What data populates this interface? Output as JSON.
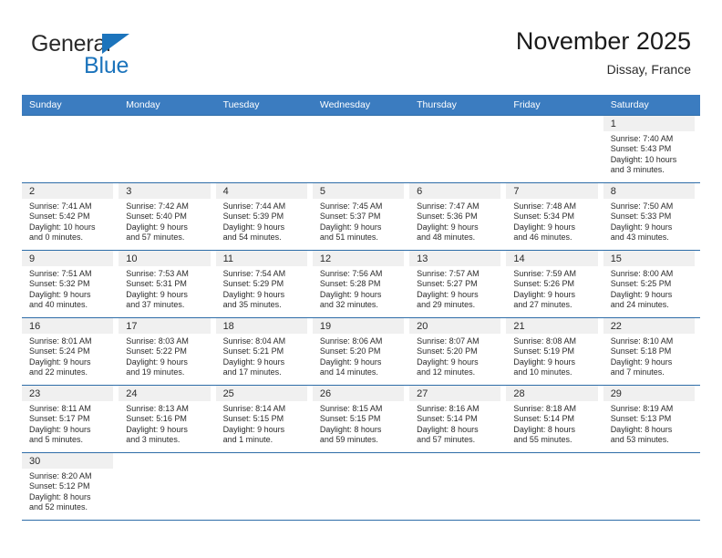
{
  "brand": {
    "name_part1": "General",
    "name_part2": "Blue",
    "triangle_color": "#1c74bc"
  },
  "header": {
    "title": "November 2025",
    "subtitle": "Dissay, France"
  },
  "colors": {
    "header_blue": "#3b7cc0",
    "row_rule_blue": "#2e6da8",
    "daynum_band": "#f0f0f0"
  },
  "weekdays": [
    "Sunday",
    "Monday",
    "Tuesday",
    "Wednesday",
    "Thursday",
    "Friday",
    "Saturday"
  ],
  "weeks": [
    [
      {
        "day": "",
        "blank": true,
        "sunrise": "",
        "sunset": "",
        "daylight1": "",
        "daylight2": ""
      },
      {
        "day": "",
        "blank": true,
        "sunrise": "",
        "sunset": "",
        "daylight1": "",
        "daylight2": ""
      },
      {
        "day": "",
        "blank": true,
        "sunrise": "",
        "sunset": "",
        "daylight1": "",
        "daylight2": ""
      },
      {
        "day": "",
        "blank": true,
        "sunrise": "",
        "sunset": "",
        "daylight1": "",
        "daylight2": ""
      },
      {
        "day": "",
        "blank": true,
        "sunrise": "",
        "sunset": "",
        "daylight1": "",
        "daylight2": ""
      },
      {
        "day": "",
        "blank": true,
        "sunrise": "",
        "sunset": "",
        "daylight1": "",
        "daylight2": ""
      },
      {
        "day": "1",
        "sunrise": "Sunrise: 7:40 AM",
        "sunset": "Sunset: 5:43 PM",
        "daylight1": "Daylight: 10 hours",
        "daylight2": "and 3 minutes."
      }
    ],
    [
      {
        "day": "2",
        "sunrise": "Sunrise: 7:41 AM",
        "sunset": "Sunset: 5:42 PM",
        "daylight1": "Daylight: 10 hours",
        "daylight2": "and 0 minutes."
      },
      {
        "day": "3",
        "sunrise": "Sunrise: 7:42 AM",
        "sunset": "Sunset: 5:40 PM",
        "daylight1": "Daylight: 9 hours",
        "daylight2": "and 57 minutes."
      },
      {
        "day": "4",
        "sunrise": "Sunrise: 7:44 AM",
        "sunset": "Sunset: 5:39 PM",
        "daylight1": "Daylight: 9 hours",
        "daylight2": "and 54 minutes."
      },
      {
        "day": "5",
        "sunrise": "Sunrise: 7:45 AM",
        "sunset": "Sunset: 5:37 PM",
        "daylight1": "Daylight: 9 hours",
        "daylight2": "and 51 minutes."
      },
      {
        "day": "6",
        "sunrise": "Sunrise: 7:47 AM",
        "sunset": "Sunset: 5:36 PM",
        "daylight1": "Daylight: 9 hours",
        "daylight2": "and 48 minutes."
      },
      {
        "day": "7",
        "sunrise": "Sunrise: 7:48 AM",
        "sunset": "Sunset: 5:34 PM",
        "daylight1": "Daylight: 9 hours",
        "daylight2": "and 46 minutes."
      },
      {
        "day": "8",
        "sunrise": "Sunrise: 7:50 AM",
        "sunset": "Sunset: 5:33 PM",
        "daylight1": "Daylight: 9 hours",
        "daylight2": "and 43 minutes."
      }
    ],
    [
      {
        "day": "9",
        "sunrise": "Sunrise: 7:51 AM",
        "sunset": "Sunset: 5:32 PM",
        "daylight1": "Daylight: 9 hours",
        "daylight2": "and 40 minutes."
      },
      {
        "day": "10",
        "sunrise": "Sunrise: 7:53 AM",
        "sunset": "Sunset: 5:31 PM",
        "daylight1": "Daylight: 9 hours",
        "daylight2": "and 37 minutes."
      },
      {
        "day": "11",
        "sunrise": "Sunrise: 7:54 AM",
        "sunset": "Sunset: 5:29 PM",
        "daylight1": "Daylight: 9 hours",
        "daylight2": "and 35 minutes."
      },
      {
        "day": "12",
        "sunrise": "Sunrise: 7:56 AM",
        "sunset": "Sunset: 5:28 PM",
        "daylight1": "Daylight: 9 hours",
        "daylight2": "and 32 minutes."
      },
      {
        "day": "13",
        "sunrise": "Sunrise: 7:57 AM",
        "sunset": "Sunset: 5:27 PM",
        "daylight1": "Daylight: 9 hours",
        "daylight2": "and 29 minutes."
      },
      {
        "day": "14",
        "sunrise": "Sunrise: 7:59 AM",
        "sunset": "Sunset: 5:26 PM",
        "daylight1": "Daylight: 9 hours",
        "daylight2": "and 27 minutes."
      },
      {
        "day": "15",
        "sunrise": "Sunrise: 8:00 AM",
        "sunset": "Sunset: 5:25 PM",
        "daylight1": "Daylight: 9 hours",
        "daylight2": "and 24 minutes."
      }
    ],
    [
      {
        "day": "16",
        "sunrise": "Sunrise: 8:01 AM",
        "sunset": "Sunset: 5:24 PM",
        "daylight1": "Daylight: 9 hours",
        "daylight2": "and 22 minutes."
      },
      {
        "day": "17",
        "sunrise": "Sunrise: 8:03 AM",
        "sunset": "Sunset: 5:22 PM",
        "daylight1": "Daylight: 9 hours",
        "daylight2": "and 19 minutes."
      },
      {
        "day": "18",
        "sunrise": "Sunrise: 8:04 AM",
        "sunset": "Sunset: 5:21 PM",
        "daylight1": "Daylight: 9 hours",
        "daylight2": "and 17 minutes."
      },
      {
        "day": "19",
        "sunrise": "Sunrise: 8:06 AM",
        "sunset": "Sunset: 5:20 PM",
        "daylight1": "Daylight: 9 hours",
        "daylight2": "and 14 minutes."
      },
      {
        "day": "20",
        "sunrise": "Sunrise: 8:07 AM",
        "sunset": "Sunset: 5:20 PM",
        "daylight1": "Daylight: 9 hours",
        "daylight2": "and 12 minutes."
      },
      {
        "day": "21",
        "sunrise": "Sunrise: 8:08 AM",
        "sunset": "Sunset: 5:19 PM",
        "daylight1": "Daylight: 9 hours",
        "daylight2": "and 10 minutes."
      },
      {
        "day": "22",
        "sunrise": "Sunrise: 8:10 AM",
        "sunset": "Sunset: 5:18 PM",
        "daylight1": "Daylight: 9 hours",
        "daylight2": "and 7 minutes."
      }
    ],
    [
      {
        "day": "23",
        "sunrise": "Sunrise: 8:11 AM",
        "sunset": "Sunset: 5:17 PM",
        "daylight1": "Daylight: 9 hours",
        "daylight2": "and 5 minutes."
      },
      {
        "day": "24",
        "sunrise": "Sunrise: 8:13 AM",
        "sunset": "Sunset: 5:16 PM",
        "daylight1": "Daylight: 9 hours",
        "daylight2": "and 3 minutes."
      },
      {
        "day": "25",
        "sunrise": "Sunrise: 8:14 AM",
        "sunset": "Sunset: 5:15 PM",
        "daylight1": "Daylight: 9 hours",
        "daylight2": "and 1 minute."
      },
      {
        "day": "26",
        "sunrise": "Sunrise: 8:15 AM",
        "sunset": "Sunset: 5:15 PM",
        "daylight1": "Daylight: 8 hours",
        "daylight2": "and 59 minutes."
      },
      {
        "day": "27",
        "sunrise": "Sunrise: 8:16 AM",
        "sunset": "Sunset: 5:14 PM",
        "daylight1": "Daylight: 8 hours",
        "daylight2": "and 57 minutes."
      },
      {
        "day": "28",
        "sunrise": "Sunrise: 8:18 AM",
        "sunset": "Sunset: 5:14 PM",
        "daylight1": "Daylight: 8 hours",
        "daylight2": "and 55 minutes."
      },
      {
        "day": "29",
        "sunrise": "Sunrise: 8:19 AM",
        "sunset": "Sunset: 5:13 PM",
        "daylight1": "Daylight: 8 hours",
        "daylight2": "and 53 minutes."
      }
    ],
    [
      {
        "day": "30",
        "sunrise": "Sunrise: 8:20 AM",
        "sunset": "Sunset: 5:12 PM",
        "daylight1": "Daylight: 8 hours",
        "daylight2": "and 52 minutes."
      },
      {
        "day": "",
        "blank": true,
        "sunrise": "",
        "sunset": "",
        "daylight1": "",
        "daylight2": ""
      },
      {
        "day": "",
        "blank": true,
        "sunrise": "",
        "sunset": "",
        "daylight1": "",
        "daylight2": ""
      },
      {
        "day": "",
        "blank": true,
        "sunrise": "",
        "sunset": "",
        "daylight1": "",
        "daylight2": ""
      },
      {
        "day": "",
        "blank": true,
        "sunrise": "",
        "sunset": "",
        "daylight1": "",
        "daylight2": ""
      },
      {
        "day": "",
        "blank": true,
        "sunrise": "",
        "sunset": "",
        "daylight1": "",
        "daylight2": ""
      },
      {
        "day": "",
        "blank": true,
        "sunrise": "",
        "sunset": "",
        "daylight1": "",
        "daylight2": ""
      }
    ]
  ]
}
